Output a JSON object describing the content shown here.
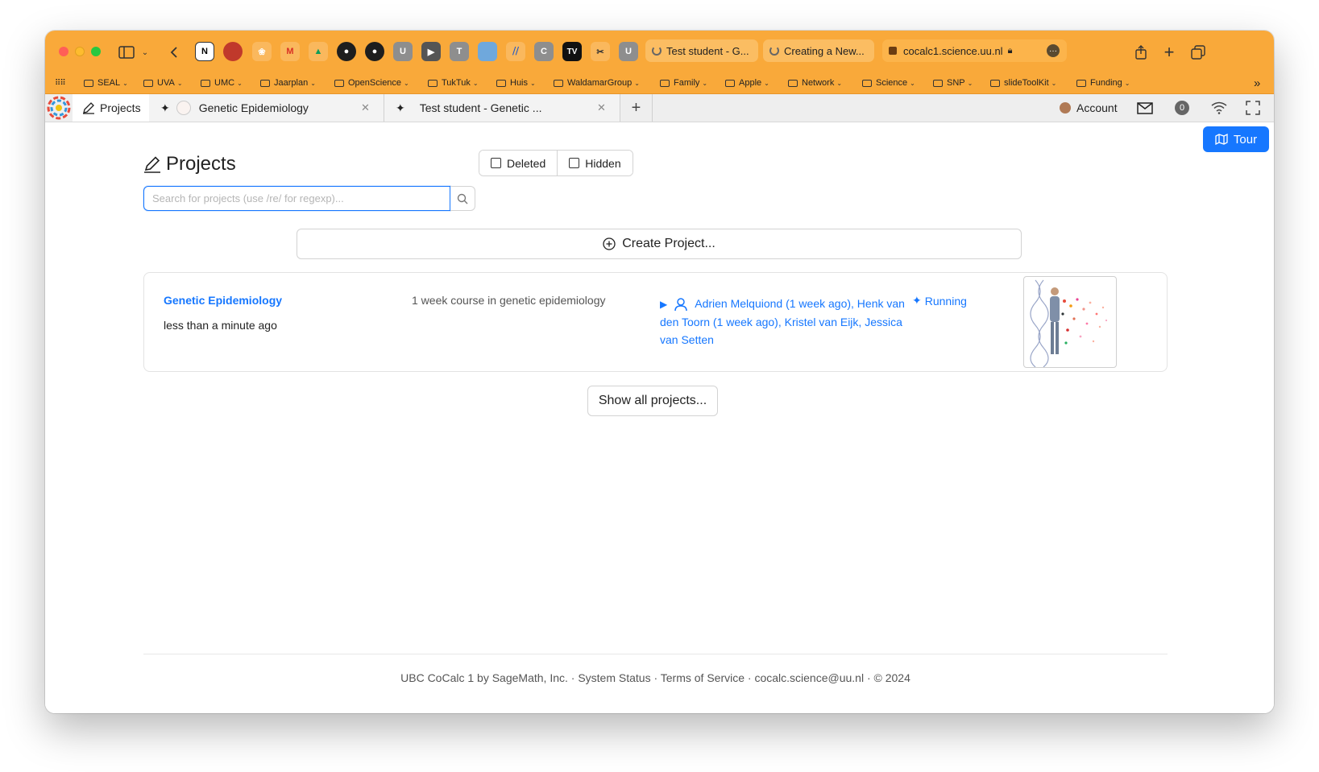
{
  "browser": {
    "tabs": [
      {
        "title": "Test student - G..."
      },
      {
        "title": "Creating a New..."
      },
      {
        "title": "cocalc1.science.uu.nl"
      }
    ],
    "favicons": [
      "U",
      "T",
      "C",
      "TV",
      "U"
    ],
    "bookmarks": [
      "SEAL",
      "UVA",
      "UMC",
      "Jaarplan",
      "OpenScience",
      "TukTuk",
      "Huis",
      "WaldamarGroup",
      "Family",
      "Apple",
      "Network",
      "Science",
      "SNP",
      "slideToolKit",
      "Funding"
    ]
  },
  "app": {
    "tabs": {
      "projects": "Projects",
      "open": [
        {
          "title": "Genetic Epidemiology"
        },
        {
          "title": "Test student - Genetic ..."
        }
      ]
    },
    "account_label": "Account",
    "notification_count": "0",
    "tour_label": "Tour"
  },
  "page": {
    "title": "Projects",
    "filters": {
      "deleted": "Deleted",
      "hidden": "Hidden"
    },
    "search": {
      "placeholder": "Search for projects (use /re/ for regexp)..."
    },
    "create_label": "Create Project...",
    "projects": [
      {
        "title": "Genetic Epidemiology",
        "last_edited": "less than a minute ago",
        "description": "1 week course in genetic epidemiology",
        "collaborators": "Adrien Melquiond (1 week ago), Henk van den Toorn (1 week ago), Kristel van Eijk, Jessica van Setten",
        "status": "Running"
      }
    ],
    "show_all_label": "Show all projects..."
  },
  "footer": {
    "text": "UBC CoCalc 1 by SageMath, Inc. · System Status · Terms of Service · cocalc.science@uu.nl · © 2024"
  },
  "colors": {
    "toolbar": "#f9a93a",
    "accent": "#1677ff"
  }
}
